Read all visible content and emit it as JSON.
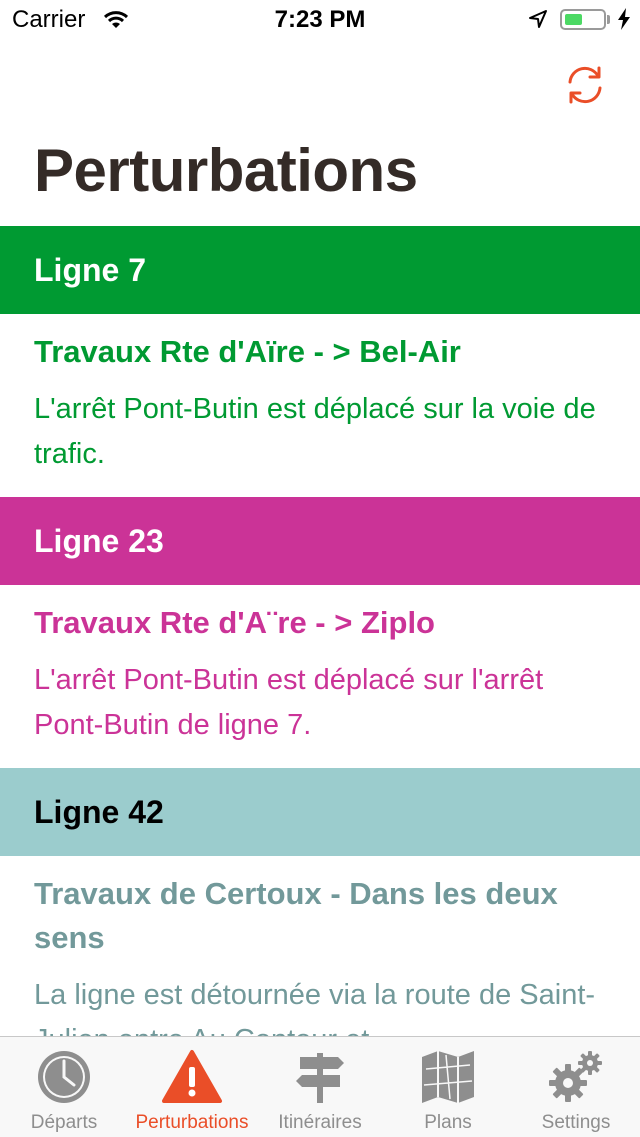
{
  "status_bar": {
    "carrier": "Carrier",
    "time": "7:23 PM",
    "battery_level": 0.45,
    "battery_color": "#4cd964"
  },
  "header": {
    "title": "Perturbations",
    "refresh_icon": "refresh-icon",
    "accent_color": "#ea4e28"
  },
  "sections": [
    {
      "header": "Ligne 7",
      "header_bg": "#009a32",
      "header_text_color": "#ffffff",
      "item_color": "#009a32",
      "items": [
        {
          "title": "Travaux Rte d'Aïre - > Bel-Air",
          "description": "L'arrêt Pont-Butin est déplacé sur la voie de trafic."
        }
      ]
    },
    {
      "header": "Ligne 23",
      "header_bg": "#cb3397",
      "header_text_color": "#ffffff",
      "item_color": "#cb3397",
      "items": [
        {
          "title": "Travaux Rte d'A¨re - > Ziplo",
          "description": "L'arrêt Pont-Butin est déplacé sur l'arrêt Pont-Butin de ligne 7."
        }
      ]
    },
    {
      "header": "Ligne 42",
      "header_bg": "#9bcccd",
      "header_text_color": "#000000",
      "item_color": "#72999a",
      "items": [
        {
          "title": "Travaux de Certoux - Dans les deux sens",
          "description": "La ligne est détournée via la route de Saint-Julien entre Au Contour et"
        }
      ]
    }
  ],
  "tab_bar": {
    "active_color": "#ea4e28",
    "inactive_color": "#8e8e8e",
    "tabs": [
      {
        "label": "Départs",
        "icon": "clock-icon",
        "active": false
      },
      {
        "label": "Perturbations",
        "icon": "warning-icon",
        "active": true
      },
      {
        "label": "Itinéraires",
        "icon": "signpost-icon",
        "active": false
      },
      {
        "label": "Plans",
        "icon": "map-icon",
        "active": false
      },
      {
        "label": "Settings",
        "icon": "gears-icon",
        "active": false
      }
    ]
  }
}
